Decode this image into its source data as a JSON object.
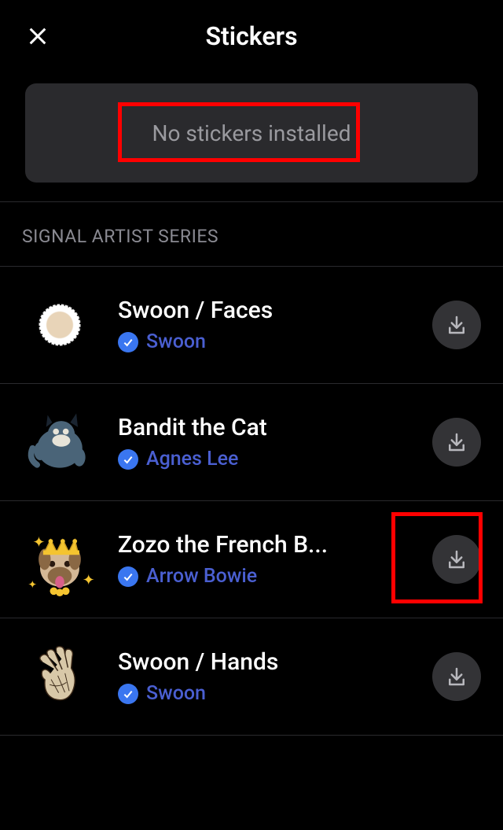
{
  "header": {
    "title": "Stickers"
  },
  "banner": {
    "text": "No stickers installed"
  },
  "section": {
    "title": "SIGNAL ARTIST SERIES",
    "items": [
      {
        "title": "Swoon / Faces",
        "artist": "Swoon",
        "avatar": "swoon-faces"
      },
      {
        "title": "Bandit the Cat",
        "artist": "Agnes Lee",
        "avatar": "bandit"
      },
      {
        "title": "Zozo the French B...",
        "artist": "Arrow Bowie",
        "avatar": "zozo",
        "highlight": true
      },
      {
        "title": "Swoon / Hands",
        "artist": "Swoon",
        "avatar": "swoon-hands"
      }
    ]
  }
}
